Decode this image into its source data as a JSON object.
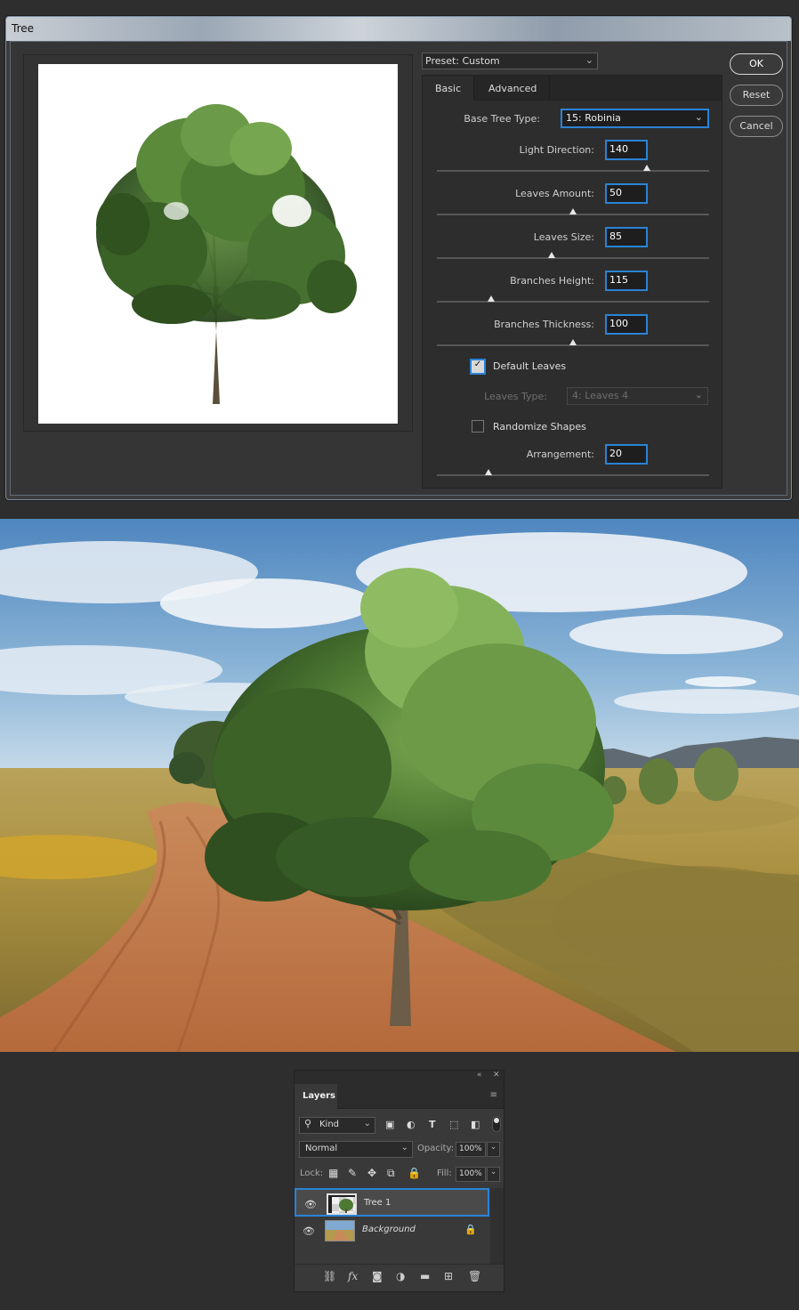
{
  "dialog": {
    "title": "Tree",
    "preset": "Preset: Custom",
    "tabs": [
      "Basic",
      "Advanced"
    ],
    "base_tree_type_label": "Base Tree Type:",
    "base_tree_type_value": "15: Robinia",
    "params": [
      {
        "label": "Light Direction:",
        "value": "140",
        "slider": 0.77
      },
      {
        "label": "Leaves Amount:",
        "value": "50",
        "slider": 0.5
      },
      {
        "label": "Leaves Size:",
        "value": "85",
        "slider": 0.42
      },
      {
        "label": "Branches Height:",
        "value": "115",
        "slider": 0.2
      },
      {
        "label": "Branches Thickness:",
        "value": "100",
        "slider": 0.5
      }
    ],
    "default_leaves_label": "Default Leaves",
    "leaves_type_label": "Leaves Type:",
    "leaves_type_value": "4: Leaves 4",
    "randomize_label": "Randomize Shapes",
    "arrangement_label": "Arrangement:",
    "arrangement_value": "20",
    "arrangement_slider": 0.19,
    "buttons": {
      "ok": "OK",
      "reset": "Reset",
      "cancel": "Cancel"
    }
  },
  "layers": {
    "tab": "Layers",
    "kind": "Kind",
    "blend_mode": "Normal",
    "opacity_label": "Opacity:",
    "opacity_value": "100%",
    "lock_label": "Lock:",
    "fill_label": "Fill:",
    "fill_value": "100%",
    "rows": [
      {
        "name": "Tree 1"
      },
      {
        "name": "Background"
      }
    ]
  },
  "icons": {
    "collapse": "«",
    "close": "✕",
    "menu": "≡",
    "search": "🔍",
    "chevron": "⌄",
    "eye": "👁",
    "lock": "🔒"
  }
}
